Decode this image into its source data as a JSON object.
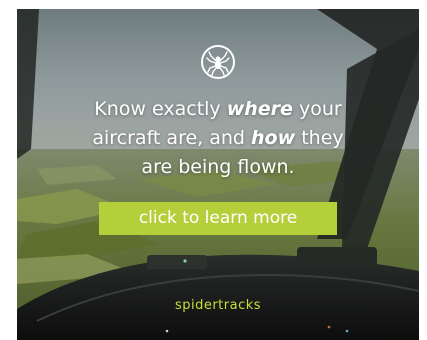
{
  "ad": {
    "headline": {
      "line1_pre": "Know exactly ",
      "line1_em": "where",
      "line1_post": " your",
      "line2_pre": "aircraft are, and ",
      "line2_em": "how",
      "line2_post": " they",
      "line3": "are being flown."
    },
    "cta_label": "click to learn more",
    "brand_label": "spidertracks",
    "colors": {
      "cta_background": "#b5cf3a",
      "cta_text": "#ffffff",
      "brand_text": "#c9de3a",
      "headline_text": "#ffffff"
    },
    "icons": {
      "logo": "spider-icon"
    }
  }
}
